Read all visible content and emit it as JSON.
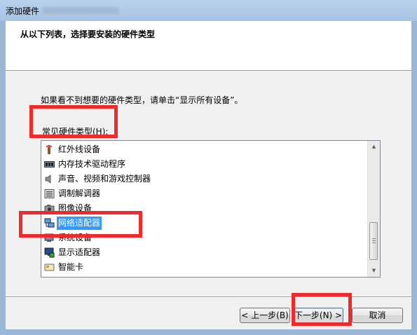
{
  "window": {
    "title": "添加硬件"
  },
  "header": {
    "heading": "从以下列表，选择要安装的硬件类型"
  },
  "main": {
    "instruction": "如果看不到想要的硬件类型，请单击“显示所有设备”。",
    "list_label": "常见硬件类型(H):",
    "items": [
      {
        "label": "红外线设备",
        "icon": "infrared-icon"
      },
      {
        "label": "内存技术驱动程序",
        "icon": "memory-icon"
      },
      {
        "label": "声音、视频和游戏控制器",
        "icon": "speaker-icon"
      },
      {
        "label": "调制解调器",
        "icon": "modem-icon"
      },
      {
        "label": "图像设备",
        "icon": "camera-icon"
      },
      {
        "label": "网络适配器",
        "icon": "network-icon",
        "selected": true
      },
      {
        "label": "系统设备",
        "icon": "system-icon"
      },
      {
        "label": "显示适配器",
        "icon": "display-icon"
      },
      {
        "label": "智能卡",
        "icon": "smartcard-icon"
      }
    ]
  },
  "buttons": {
    "back": "< 上一步(B)",
    "next": "下一步(N) >",
    "cancel": "取消"
  },
  "colors": {
    "selection": "#3399ff",
    "annotation": "#ee2a2a"
  }
}
